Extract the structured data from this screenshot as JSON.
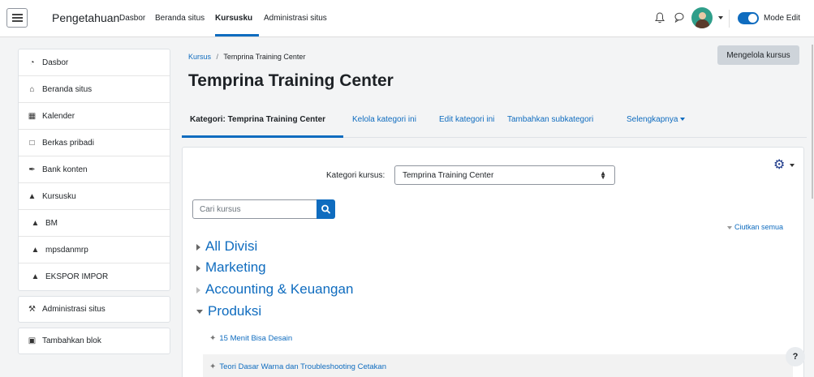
{
  "navbar": {
    "brand": "Pengetahuan",
    "links": [
      {
        "label": "Dasbor",
        "active": false
      },
      {
        "label": "Beranda situs",
        "active": false
      },
      {
        "label": "Kursusku",
        "active": true
      },
      {
        "label": "Administrasi situs",
        "active": false
      }
    ],
    "icons": [
      "menu-icon",
      "bell-icon",
      "chat-icon",
      "avatar",
      "chevron-down-icon"
    ],
    "mode_edit_label": "Mode Edit",
    "mode_edit_on": true,
    "accent_color": "#0f6cbf"
  },
  "sidebar": {
    "items": [
      {
        "label": "Dasbor",
        "icon": "dashboard-icon"
      },
      {
        "label": "Beranda situs",
        "icon": "home-icon"
      },
      {
        "label": "Kalender",
        "icon": "calendar-icon"
      },
      {
        "label": "Berkas pribadi",
        "icon": "file-icon"
      },
      {
        "label": "Bank konten",
        "icon": "brush-icon"
      },
      {
        "label": "Kursusku",
        "icon": "graduation-cap-icon"
      },
      {
        "label": "BM",
        "icon": "graduation-cap-icon"
      },
      {
        "label": "mpsdanmrp",
        "icon": "graduation-cap-icon"
      },
      {
        "label": "EKSPOR IMPOR",
        "icon": "graduation-cap-icon"
      }
    ],
    "admin_label": "Administrasi situs",
    "add_block_label": "Tambahkan blok"
  },
  "breadcrumb": {
    "root": "Kursus",
    "separator": "/",
    "current": "Temprina Training Center"
  },
  "manage_button": "Mengelola kursus",
  "page_title": "Temprina Training Center",
  "tabs": [
    {
      "label": "Kategori: Temprina Training Center",
      "active": true
    },
    {
      "label": "Kelola kategori ini",
      "active": false
    },
    {
      "label": "Edit kategori ini",
      "active": false
    },
    {
      "label": "Tambahkan subkategori",
      "active": false
    },
    {
      "label": "Selengkapnya",
      "active": false
    }
  ],
  "category_select": {
    "label": "Kategori kursus:",
    "value": "Temprina Training Center"
  },
  "search": {
    "placeholder": "Cari kursus"
  },
  "collapse_all": "Ciutkan semua",
  "categories": [
    {
      "label": "All Divisi",
      "state": "collapsed"
    },
    {
      "label": "Marketing",
      "state": "collapsed"
    },
    {
      "label": "Accounting & Keuangan",
      "state": "empty"
    },
    {
      "label": "Produksi",
      "state": "expanded"
    }
  ],
  "courses": [
    {
      "label": "15 Menit Bisa Desain"
    },
    {
      "label": "Teori Dasar Warna dan Troubleshooting Cetakan"
    }
  ],
  "help_label": "?"
}
